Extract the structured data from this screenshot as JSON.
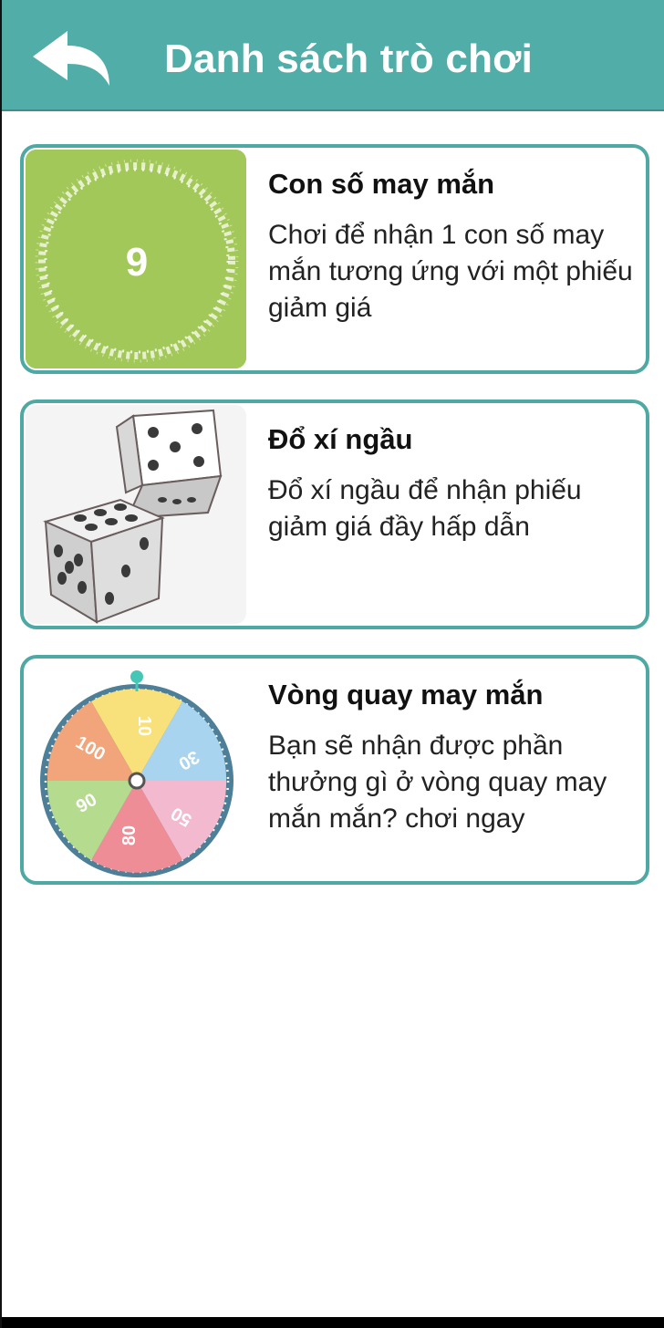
{
  "header": {
    "title": "Danh sách trò chơi",
    "back_icon": "back-arrow-icon",
    "bg_color": "#51ada8"
  },
  "games": [
    {
      "title": "Con số may mắn",
      "description": "Chơi để nhận 1 con số may mắn tương ứng với một phiếu giảm giá",
      "thumb_number": "9",
      "thumb_color": "#a3c85a"
    },
    {
      "title": "Đổ xí ngầu",
      "description": "Đổ xí ngầu để nhận phiếu giảm giá đầy hấp dẫn",
      "icon": "dice-icon"
    },
    {
      "title": "Vòng quay may mắn",
      "description": "Bạn sẽ nhận được phần thưởng gì ở vòng quay may mắn mắn? chơi ngay",
      "wheel_labels": [
        "10",
        "30",
        "50",
        "80",
        "90",
        "100"
      ]
    }
  ],
  "accent_color": "#4ea9a4"
}
